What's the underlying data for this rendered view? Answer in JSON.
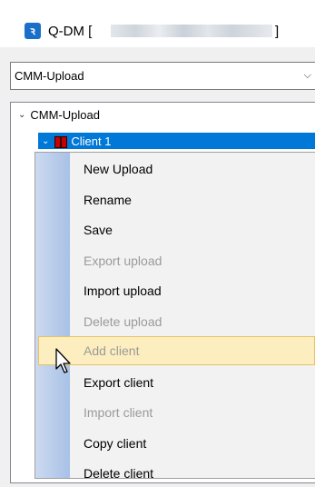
{
  "window": {
    "app_icon": "Q-DM app icon",
    "title": "Q-DM [",
    "title_close_bracket": "]"
  },
  "combo": {
    "value": "CMM-Upload",
    "arrow_icon": "chevron-down-icon"
  },
  "tree": {
    "root_label": "CMM-Upload",
    "child_label": "Client 1",
    "child_icon": "client-icon"
  },
  "context_menu": {
    "items": [
      {
        "label": "New Upload",
        "enabled": true
      },
      {
        "label": "Rename",
        "enabled": true
      },
      {
        "label": "Save",
        "enabled": true
      },
      {
        "label": "Export upload",
        "enabled": false
      },
      {
        "label": "Import upload",
        "enabled": true
      },
      {
        "label": "Delete upload",
        "enabled": false
      },
      {
        "label": "Add client",
        "enabled": false,
        "hovered": true
      },
      {
        "label": "Export client",
        "enabled": true
      },
      {
        "label": "Import client",
        "enabled": false
      },
      {
        "label": "Copy client",
        "enabled": true
      },
      {
        "label": "Delete client",
        "enabled": true
      }
    ]
  },
  "colors": {
    "selection": "#0078d7",
    "hover_fill": "#fdeec0",
    "hover_border": "#e5c365",
    "disabled_text": "#9a9a9a"
  }
}
